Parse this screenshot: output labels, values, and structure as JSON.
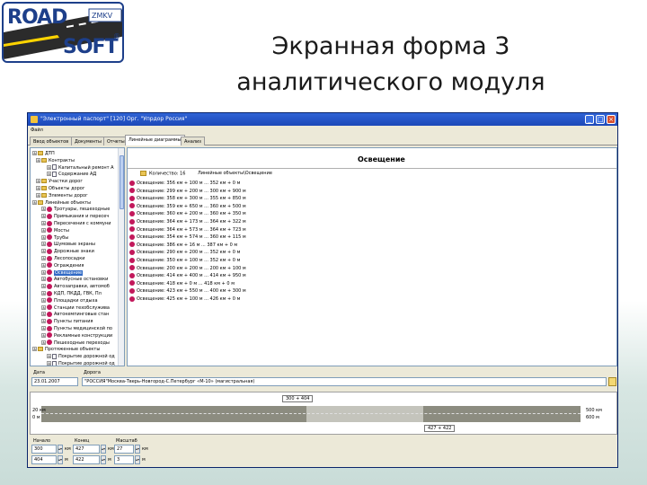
{
  "logo": {
    "line1": "ROAD",
    "line2": "SOFT",
    "reg": "®"
  },
  "slide": {
    "title_line1": "Экранная форма 3",
    "title_line2": "аналитического модуля"
  },
  "window": {
    "title": "\"Электронный паспорт\" [120] Орг. \"Упрдор Россия\"",
    "menu": "Файл",
    "tabs": [
      "Ввод объектов",
      "Документы",
      "Отчеты",
      "Линейные диаграммы",
      "Анализ"
    ],
    "active_tab": 3
  },
  "tree": {
    "items": [
      {
        "label": "ДТП",
        "type": "folder"
      },
      {
        "label": "Контракты",
        "type": "folder"
      },
      {
        "label": "Капитальный ремонт А",
        "type": "doc"
      },
      {
        "label": "Содержание АД",
        "type": "doc"
      },
      {
        "label": "Участки дорог",
        "type": "folder"
      },
      {
        "label": "Объекты дорог",
        "type": "folder"
      },
      {
        "label": "Элементы дорог",
        "type": "folder"
      },
      {
        "label": "Линейные объекты",
        "type": "folder"
      },
      {
        "label": "Тротуары, пешеходные",
        "type": "road"
      },
      {
        "label": "Примыкания и пересеч",
        "type": "road"
      },
      {
        "label": "Пересечения с коммуни",
        "type": "road"
      },
      {
        "label": "Мосты",
        "type": "road"
      },
      {
        "label": "Трубы",
        "type": "road"
      },
      {
        "label": "Шумовые экраны",
        "type": "road"
      },
      {
        "label": "Дорожные знаки",
        "type": "road"
      },
      {
        "label": "Лесопосадки",
        "type": "road"
      },
      {
        "label": "Ограждения",
        "type": "road"
      },
      {
        "label": "Освещение",
        "type": "road"
      },
      {
        "label": "Автобусные остановки",
        "type": "road"
      },
      {
        "label": "Автозаправки, автомоб",
        "type": "road"
      },
      {
        "label": "КДП, ПКДД, ГВК, Пл",
        "type": "road"
      },
      {
        "label": "Площадки отдыха",
        "type": "road"
      },
      {
        "label": "Станции техобслужива",
        "type": "road"
      },
      {
        "label": "Автокемпинговые стан",
        "type": "road"
      },
      {
        "label": "Пункты питания",
        "type": "road"
      },
      {
        "label": "Пункты медицинской по",
        "type": "road"
      },
      {
        "label": "Рекламные конструкции",
        "type": "road"
      },
      {
        "label": "Пешеходные переходы",
        "type": "road"
      },
      {
        "label": "Протяженные объекты",
        "type": "folder"
      },
      {
        "label": "Покрытие дорожной од",
        "type": "doc"
      },
      {
        "label": "Покрытие дорожной од",
        "type": "doc"
      }
    ],
    "selected_index": 17
  },
  "pane": {
    "title": "Освещение",
    "count_text": "Количество: 16",
    "path_text": "Линейные объекты\\Освещение",
    "rows": [
      "Освещение: 356 км + 100 м ... 352 км + 0 м",
      "Освещение: 299 км + 200 м ... 300 км + 900 м",
      "Освещение: 358 км + 300 м ... 355 км + 850 м",
      "Освещение: 359 км + 650 м ... 360 км + 500 м",
      "Освещение: 360 км + 200 м ... 360 км + 350 м",
      "Освещение: 364 км + 173 м ... 364 км + 322 м",
      "Освещение: 364 км + 573 м ... 364 км + 723 м",
      "Освещение: 354 км + 574 м ... 360 км + 115 м",
      "Освещение: 386 км + 16 м ... 387 км + 0 м",
      "Освещение: 290 км + 200 м ... 352 км + 0 м",
      "Освещение: 350 км + 100 м ... 352 км + 0 м",
      "Освещение: 200 км + 200 м ... 200 км + 100 м",
      "Освещение: 414 км + 400 м ... 414 км + 950 м",
      "Освещение: 418 км + 0 м ... 418 км + 0 м",
      "Освещение: 423 км + 550 м ... 400 км + 300 м",
      "Освещение: 425 км + 100 м ... 426 км + 0 м"
    ]
  },
  "road_section": {
    "date_label": "Дата",
    "date_value": "23.01.2007",
    "road_label": "Дорога",
    "road_value": "\"РОССИЯ\"Москва-Тверь-Новгород-С.Петербург «М-10» (магистральная)"
  },
  "strip": {
    "top_tag": "300 + 404",
    "left_top": "20 км",
    "left_bottom": "0 м",
    "right_top": "500 км",
    "right_bottom": "600 м",
    "bottom_tag": "427 + 422"
  },
  "bottom": {
    "start_label": "Начало",
    "start_km": "300",
    "start_m": "404",
    "end_label": "Конец",
    "end_km": "427",
    "end_m": "422",
    "scale_label": "Масштаб",
    "scale_a": "27",
    "scale_b": "3",
    "unit_km": "км",
    "unit_m": "м"
  }
}
